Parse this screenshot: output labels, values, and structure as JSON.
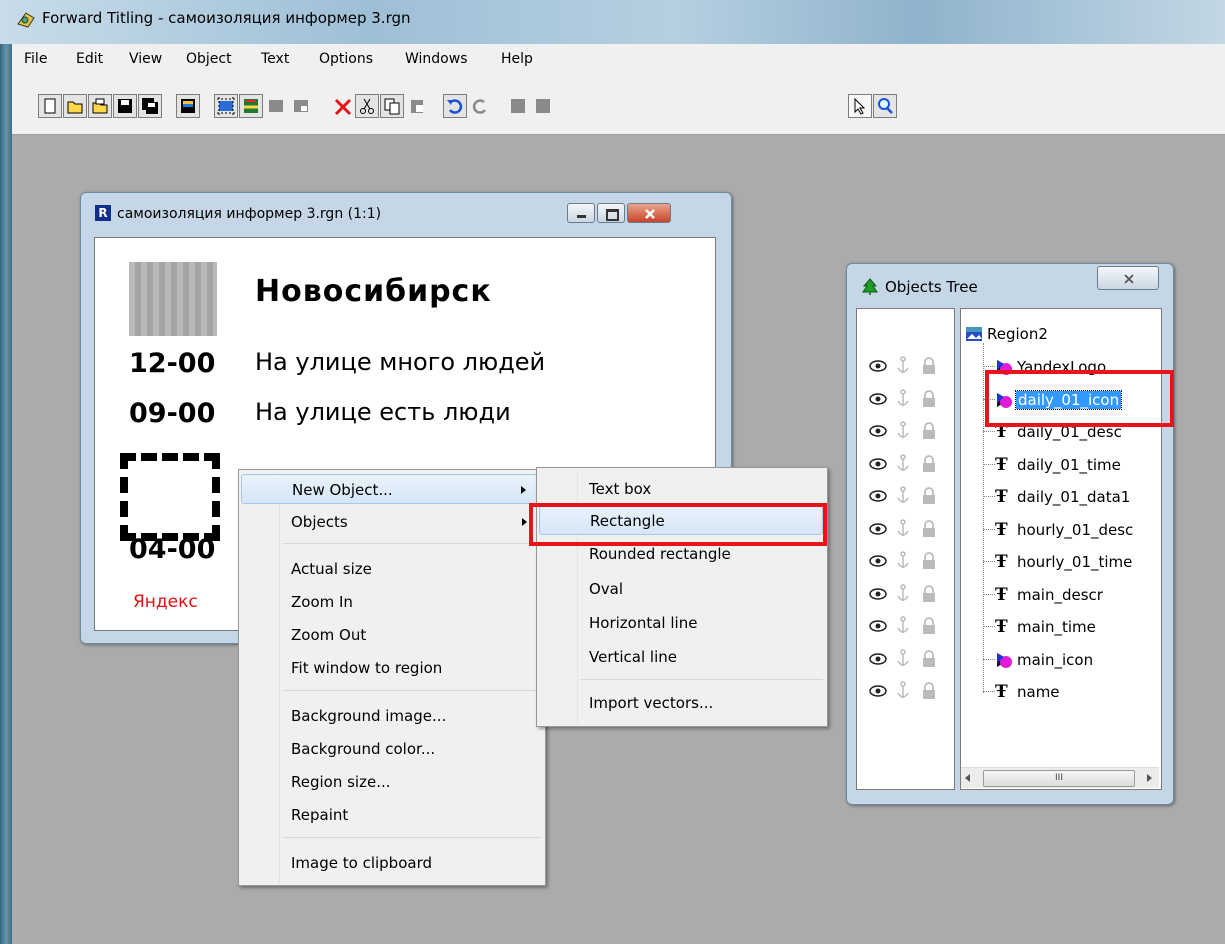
{
  "app": {
    "title": "Forward Titling - самоизоляция информер 3.rgn"
  },
  "menubar": [
    "File",
    "Edit",
    "View",
    "Object",
    "Text",
    "Options",
    "Windows",
    "Help"
  ],
  "doc_window": {
    "title": "самоизоляция информер 3.rgn  (1:1)",
    "city": "Новосибирск",
    "rows": [
      {
        "time": "12-00",
        "desc": "На улице много людей"
      },
      {
        "time": "09-00",
        "desc": "На улице есть люди"
      }
    ],
    "time3": "04-00",
    "logo_text": "Яндекс"
  },
  "context_menu": {
    "items": [
      {
        "label": "New Object...",
        "submenu": true,
        "highlighted": true
      },
      {
        "label": "Objects",
        "submenu": true
      },
      {
        "label": "Actual size"
      },
      {
        "label": "Zoom In"
      },
      {
        "label": "Zoom Out"
      },
      {
        "label": "Fit window to region"
      },
      {
        "label": "Background image..."
      },
      {
        "label": "Background color..."
      },
      {
        "label": "Region size..."
      },
      {
        "label": "Repaint"
      },
      {
        "label": "Image to clipboard"
      }
    ]
  },
  "submenu": {
    "items": [
      {
        "label": "Text box"
      },
      {
        "label": "Rectangle",
        "highlighted": true
      },
      {
        "label": "Rounded rectangle"
      },
      {
        "label": "Oval"
      },
      {
        "label": "Horizontal line"
      },
      {
        "label": "Vertical line"
      },
      {
        "label": "Import vectors..."
      }
    ]
  },
  "objects_tree": {
    "title": "Objects Tree",
    "root": "Region2",
    "items": [
      {
        "label": "YandexLogo",
        "icon": "shape-icon"
      },
      {
        "label": "daily_01_icon",
        "icon": "shape-icon",
        "selected": true
      },
      {
        "label": "daily_01_desc",
        "icon": "text-icon"
      },
      {
        "label": "daily_01_time",
        "icon": "text-icon"
      },
      {
        "label": "daily_01_data1",
        "icon": "text-icon"
      },
      {
        "label": "hourly_01_desc",
        "icon": "text-icon"
      },
      {
        "label": "hourly_01_time",
        "icon": "text-icon"
      },
      {
        "label": "main_descr",
        "icon": "text-icon"
      },
      {
        "label": "main_time",
        "icon": "text-icon"
      },
      {
        "label": "main_icon",
        "icon": "shape-icon"
      },
      {
        "label": "name",
        "icon": "text-icon"
      }
    ],
    "scrollbar_thumb": "III"
  },
  "colors": {
    "highlight_box": "#e8141b",
    "selection": "#3399ff"
  }
}
